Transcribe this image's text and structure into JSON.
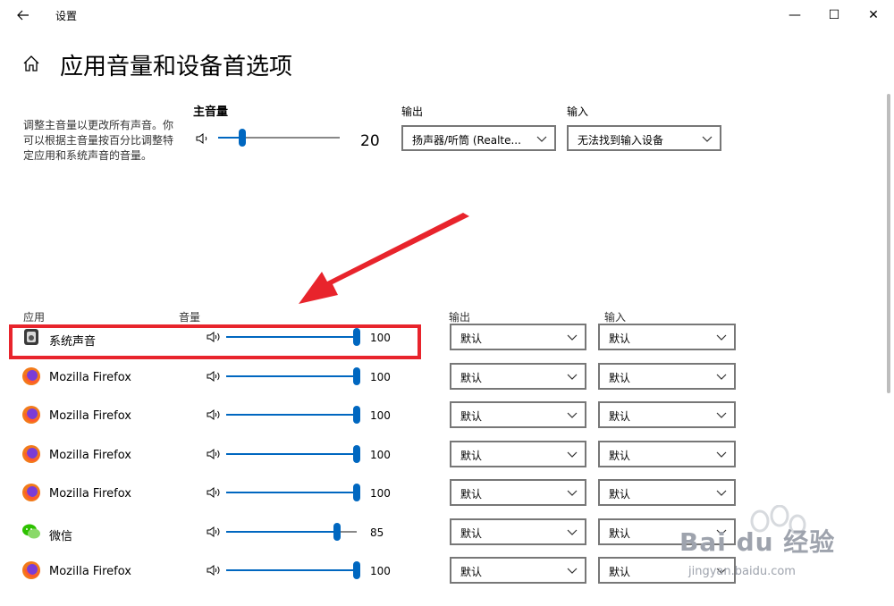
{
  "window": {
    "title": "设置",
    "back_icon": "back-arrow-icon",
    "minimize_glyph": "—",
    "maximize_glyph": "☐",
    "close_glyph": "✕"
  },
  "page": {
    "title": "应用音量和设备首选项",
    "description": "调整主音量以更改所有声音。你可以根据主音量按百分比调整特定应用和系统声音的音量。"
  },
  "master": {
    "label": "主音量",
    "value": 20,
    "value_text": "20",
    "output_label": "输出",
    "output_value": "扬声器/听筒 (Realte...",
    "input_label": "输入",
    "input_value": "无法找到输入设备"
  },
  "columns": {
    "app": "应用",
    "volume": "音量",
    "output": "输出",
    "input": "输入"
  },
  "apps": [
    {
      "name": "系统声音",
      "icon": "system-sounds-icon",
      "volume": 100,
      "volume_text": "100",
      "output": "默认",
      "input": "默认"
    },
    {
      "name": "Mozilla Firefox",
      "icon": "firefox-icon",
      "volume": 100,
      "volume_text": "100",
      "output": "默认",
      "input": "默认"
    },
    {
      "name": "Mozilla Firefox",
      "icon": "firefox-icon",
      "volume": 100,
      "volume_text": "100",
      "output": "默认",
      "input": "默认"
    },
    {
      "name": "Mozilla Firefox",
      "icon": "firefox-icon",
      "volume": 100,
      "volume_text": "100",
      "output": "默认",
      "input": "默认"
    },
    {
      "name": "Mozilla Firefox",
      "icon": "firefox-icon",
      "volume": 100,
      "volume_text": "100",
      "output": "默认",
      "input": "默认"
    },
    {
      "name": "微信",
      "icon": "wechat-icon",
      "volume": 85,
      "volume_text": "85",
      "output": "默认",
      "input": "默认"
    },
    {
      "name": "Mozilla Firefox",
      "icon": "firefox-icon",
      "volume": 100,
      "volume_text": "100",
      "output": "默认",
      "input": "默认"
    }
  ],
  "watermark": {
    "text": "Bai du 经验",
    "url": "jingyan.baidu.com"
  },
  "colors": {
    "accent": "#0067c0",
    "highlight": "#e8242c"
  }
}
